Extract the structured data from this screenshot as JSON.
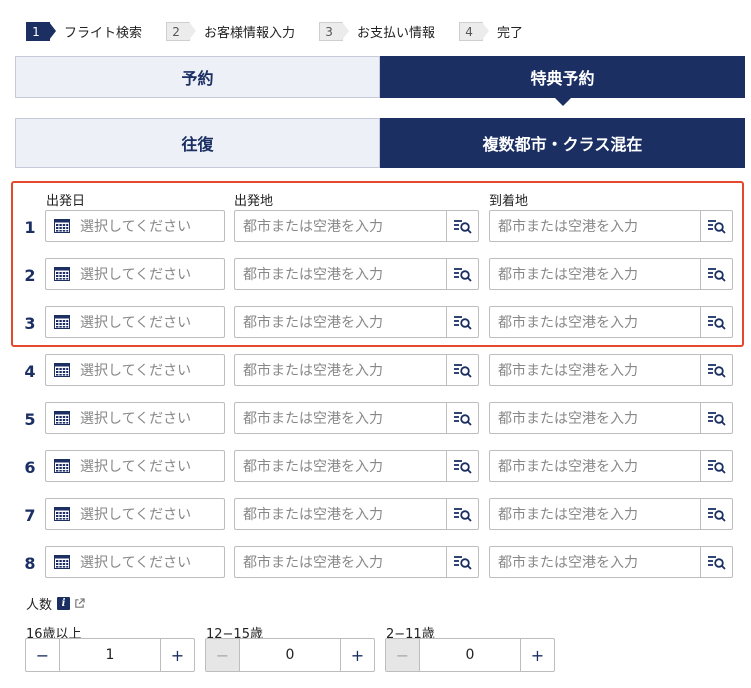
{
  "steps": [
    {
      "num": "1",
      "label": "フライト検索"
    },
    {
      "num": "2",
      "label": "お客様情報入力"
    },
    {
      "num": "3",
      "label": "お支払い情報"
    },
    {
      "num": "4",
      "label": "完了"
    }
  ],
  "booking_tabs": {
    "reserve": "予約",
    "award": "特典予約"
  },
  "trip_tabs": {
    "roundtrip": "往復",
    "multicity": "複数都市・クラス混在"
  },
  "columns": {
    "date": "出発日",
    "origin": "出発地",
    "destination": "到着地"
  },
  "segments": [
    {
      "num": "1",
      "date_placeholder": "選択してください",
      "origin_placeholder": "都市または空港を入力",
      "dest_placeholder": "都市または空港を入力"
    },
    {
      "num": "2",
      "date_placeholder": "選択してください",
      "origin_placeholder": "都市または空港を入力",
      "dest_placeholder": "都市または空港を入力"
    },
    {
      "num": "3",
      "date_placeholder": "選択してください",
      "origin_placeholder": "都市または空港を入力",
      "dest_placeholder": "都市または空港を入力"
    },
    {
      "num": "4",
      "date_placeholder": "選択してください",
      "origin_placeholder": "都市または空港を入力",
      "dest_placeholder": "都市または空港を入力"
    },
    {
      "num": "5",
      "date_placeholder": "選択してください",
      "origin_placeholder": "都市または空港を入力",
      "dest_placeholder": "都市または空港を入力"
    },
    {
      "num": "6",
      "date_placeholder": "選択してください",
      "origin_placeholder": "都市または空港を入力",
      "dest_placeholder": "都市または空港を入力"
    },
    {
      "num": "7",
      "date_placeholder": "選択してください",
      "origin_placeholder": "都市または空港を入力",
      "dest_placeholder": "都市または空港を入力"
    },
    {
      "num": "8",
      "date_placeholder": "選択してください",
      "origin_placeholder": "都市または空港を入力",
      "dest_placeholder": "都市または空港を入力"
    }
  ],
  "passengers": {
    "title": "人数",
    "info_icon_glyph": "i",
    "groups": [
      {
        "label": "16歳以上",
        "value": "1",
        "minus": "−",
        "plus": "+",
        "minus_disabled": false
      },
      {
        "label": "12−15歳",
        "value": "0",
        "minus": "−",
        "plus": "+",
        "minus_disabled": true
      },
      {
        "label": "2−11歳",
        "value": "0",
        "minus": "−",
        "plus": "+",
        "minus_disabled": true
      }
    ]
  },
  "colors": {
    "brand_navy": "#1b2f63",
    "highlight": "#e5492d"
  }
}
